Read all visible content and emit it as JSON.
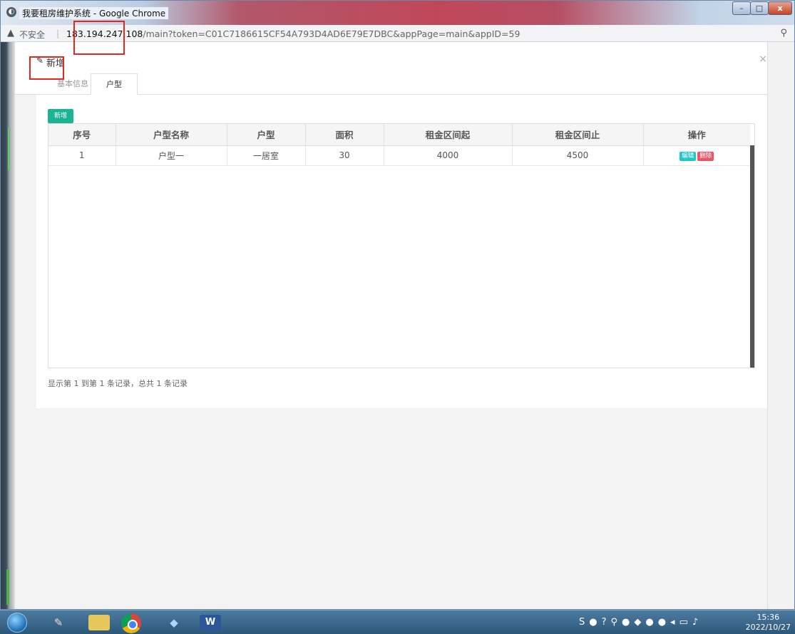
{
  "window": {
    "title": "我要租房维护系统 - Google Chrome",
    "controls": {
      "minimize": "–",
      "maximize": "□",
      "close": "x"
    }
  },
  "address_bar": {
    "security_label": "不安全",
    "url_host": "183.194.247.108",
    "url_path": "/main?token=C01C7186615CF54A793D4AD6E79E7DBC&appPage=main&appID=59"
  },
  "modal": {
    "title": "新增",
    "close": "×",
    "tabs": [
      {
        "label": "基本信息",
        "active": false
      },
      {
        "label": "户型",
        "active": true
      }
    ],
    "add_button": "新增",
    "table": {
      "headers": [
        "序号",
        "户型名称",
        "户型",
        "面积",
        "租金区间起",
        "租金区间止",
        "操作"
      ],
      "rows": [
        {
          "index": "1",
          "name": "户型一",
          "type": "一居室",
          "area": "30",
          "rent_from": "4000",
          "rent_to": "4500",
          "edit": "编辑",
          "delete": "删除"
        }
      ]
    },
    "pagination_info": "显示第 1 到第 1 条记录，总共 1 条记录"
  },
  "taskbar": {
    "clock_time": "15:36",
    "clock_date": "2022/10/27"
  },
  "colors": {
    "accent_green": "#1ab394",
    "edit_cyan": "#23c6c8",
    "delete_red": "#ed5565",
    "highlight_box": "#e0281f"
  }
}
